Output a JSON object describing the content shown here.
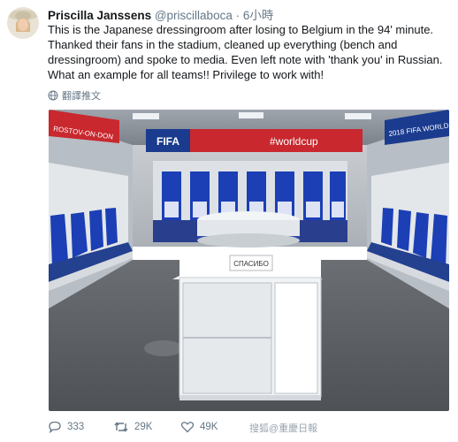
{
  "author": {
    "name": "Priscilla Janssens",
    "handle": "@priscillaboca",
    "separator": "·",
    "time": "6小時"
  },
  "tweet_lines": [
    "This is the Japanese dressingroom after losing to Belgium in the 94' minute.",
    "Thanked their fans in the stadium, cleaned up everything (bench and",
    "dressingroom) and spoke to media. Even left note with 'thank you' in Russian.",
    "What an example for all teams!! Privilege to work with!"
  ],
  "translate_label": "翻譯推文",
  "photo": {
    "banner_fifa": "FIFA",
    "banner_hashtag": "#worldcup",
    "banner_left": "ROSTOV-ON-DON",
    "banner_right": "2018 FIFA WORLD",
    "note_text": "СПАСИБО"
  },
  "actions": {
    "replies": "333",
    "retweets": "29K",
    "likes": "49K"
  },
  "watermark": "搜狐@重慶日報",
  "colors": {
    "text": "#14171a",
    "secondary": "#657786",
    "seat_blue": "#1c3fb5",
    "banner_red": "#c8282e"
  }
}
